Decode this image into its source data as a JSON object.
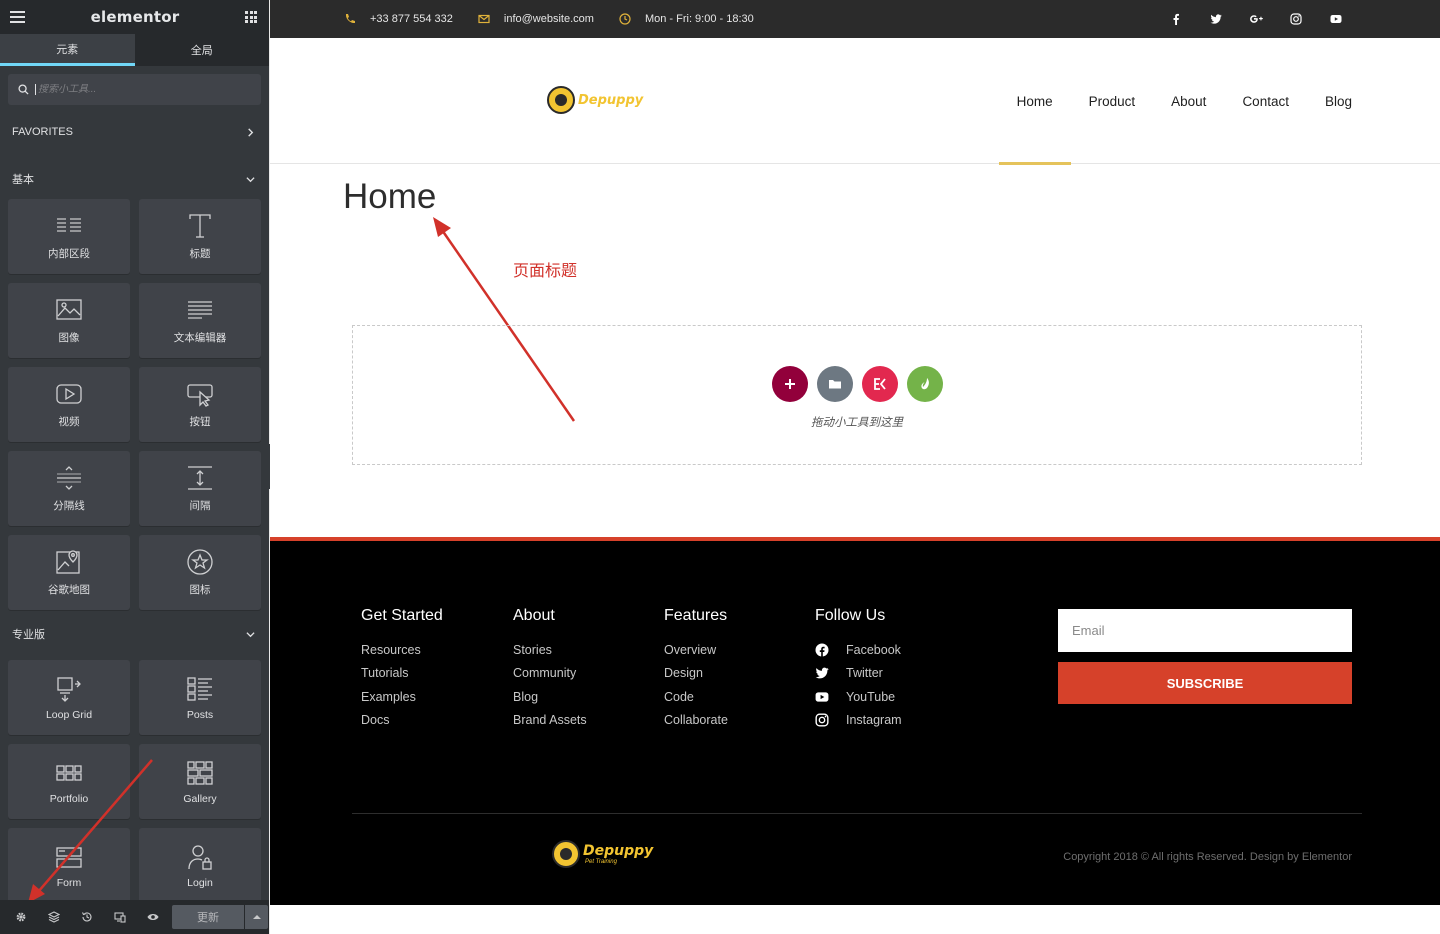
{
  "panel": {
    "logo": "elementor",
    "tabs": [
      "元素",
      "全局"
    ],
    "search_placeholder": "搜索小工具...",
    "favorites_label": "FAVORITES",
    "basic_label": "基本",
    "pro_label": "专业版",
    "basic_widgets": [
      "内部区段",
      "标题",
      "图像",
      "文本编辑器",
      "视频",
      "按钮",
      "分隔线",
      "间隔",
      "谷歌地图",
      "图标"
    ],
    "pro_widgets": [
      "Loop Grid",
      "Posts",
      "Portfolio",
      "Gallery",
      "Form",
      "Login"
    ],
    "update_label": "更新"
  },
  "topbar": {
    "phone": "+33 877 554 332",
    "email": "info@website.com",
    "hours": "Mon - Fri: 9:00 - 18:30"
  },
  "header": {
    "logo_text": "Depuppy",
    "nav": [
      "Home",
      "Product",
      "About",
      "Contact",
      "Blog"
    ],
    "active_nav": "Home"
  },
  "page": {
    "title": "Home",
    "annotation": "页面标题",
    "drop_hint": "拖动小工具到这里"
  },
  "footer": {
    "columns": [
      {
        "heading": "Get Started",
        "links": [
          "Resources",
          "Tutorials",
          "Examples",
          "Docs"
        ]
      },
      {
        "heading": "About",
        "links": [
          "Stories",
          "Community",
          "Blog",
          "Brand Assets"
        ]
      },
      {
        "heading": "Features",
        "links": [
          "Overview",
          "Design",
          "Code",
          "Collaborate"
        ]
      }
    ],
    "follow": {
      "heading": "Follow Us",
      "links": [
        "Facebook",
        "Twitter",
        "YouTube",
        "Instagram"
      ]
    },
    "email_placeholder": "Email",
    "subscribe_label": "SUBSCRIBE",
    "logo_text": "Depuppy",
    "logo_sub": "Pet Training",
    "copyright": "Copyright 2018 © All rights Reserved. Design by Elementor"
  },
  "colors": {
    "panel_bg": "#34383c",
    "accent_blue": "#71d7f7",
    "annotation_red": "#d1312a",
    "brand_yellow": "#f2c431",
    "footer_accent": "#d6412a"
  }
}
